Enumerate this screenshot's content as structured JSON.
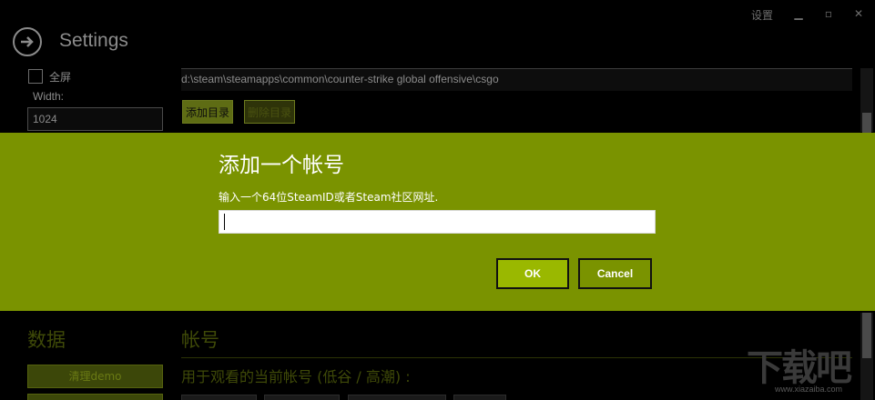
{
  "titlebar": {
    "settings_label": "设置",
    "minimize_glyph": "▁",
    "maximize_glyph": "▫",
    "close_glyph": "✕"
  },
  "header": {
    "title": "Settings"
  },
  "display": {
    "fullscreen_label": "全屏",
    "width_label": "Width:",
    "width_value": "1024"
  },
  "paths": {
    "path_value": "d:\\steam\\steamapps\\common\\counter-strike global offensive\\csgo",
    "add_dir_label": "添加目录",
    "remove_dir_label": "删除目录"
  },
  "dialog": {
    "title": "添加一个帐号",
    "prompt": "输入一个64位SteamID或者Steam社区网址.",
    "input_value": "",
    "ok_label": "OK",
    "cancel_label": "Cancel"
  },
  "data_section": {
    "title": "数据",
    "clear_demo_label": "清理demo"
  },
  "account_section": {
    "title": "帐号",
    "description": "用于观看的当前帐号 (低谷 / 高潮) :"
  },
  "watermark": {
    "text": "下载吧",
    "url": "www.xiazaiba.com"
  },
  "colors": {
    "accent": "#7a9300",
    "ok_button": "#9ab800",
    "background": "#000000"
  }
}
